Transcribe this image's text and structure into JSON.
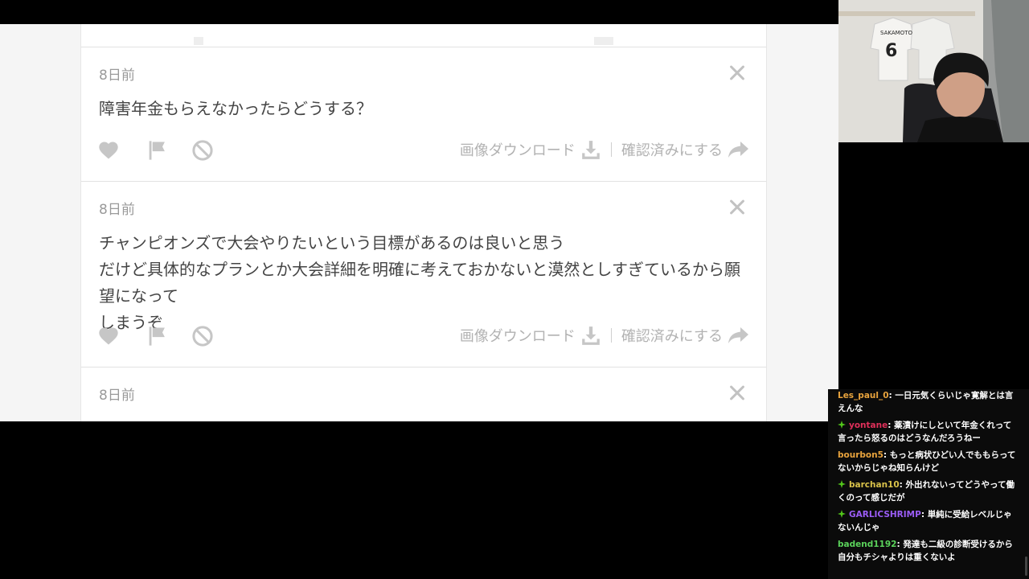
{
  "cards": [
    {
      "time": "8日前",
      "text": "障害年金もらえなかったらどうする？",
      "download_label": "画像ダウンロード",
      "confirm_label": "確認済みにする"
    },
    {
      "time": "8日前",
      "text": "チャンピオンズで大会やりたいという目標があるのは良いと思う\nだけど具体的なプランとか大会詳細を明確に考えておかないと漠然としすぎているから願望になって\nしまうぞ",
      "download_label": "画像ダウンロード",
      "confirm_label": "確認済みにする"
    },
    {
      "time": "8日前"
    }
  ],
  "icons": {
    "heart": "heart-icon",
    "flag": "flag-icon",
    "ban": "block-icon",
    "download": "download-icon",
    "share": "share-arrow-icon",
    "close": "close-icon"
  },
  "chat": [
    {
      "user": "Les_paul_0",
      "color": "#e8a33d",
      "badge": false,
      "text": "一日元気くらいじゃ寛解とは言えんな"
    },
    {
      "user": "yontane",
      "color": "#e0305a",
      "badge": true,
      "text": "薬漬けにしといて年金くれって言ったら怒るのはどうなんだろうねー"
    },
    {
      "user": "bourbon5",
      "color": "#e8a33d",
      "badge": false,
      "text": "もっと病状ひどい人でももらってないからじゃね知らんけど"
    },
    {
      "user": "barchan10",
      "color": "#d9c24a",
      "badge": true,
      "text": "外出れないってどうやって働くのって感じだが"
    },
    {
      "user": "GARLICSHRIMP",
      "color": "#9b5cf6",
      "badge": true,
      "text": "単純に受給レベルじゃないんじゃ"
    },
    {
      "user": "badend1192",
      "color": "#5bd35b",
      "badge": false,
      "text": "発達も二級の診断受けるから自分もチシャよりは重くないよ"
    }
  ],
  "webcam": {
    "jersey_name": "SAKAMOTO",
    "jersey_number": "6"
  }
}
